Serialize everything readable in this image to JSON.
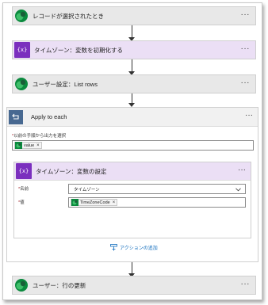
{
  "steps": {
    "trigger": {
      "title": "レコードが選択されたとき",
      "icon": "dataverse-icon"
    },
    "init_var": {
      "title": "タイムゾーン：変数を初期化する",
      "icon": "variable-icon"
    },
    "list_rows": {
      "title": "ユーザー設定：List rows",
      "icon": "dataverse-icon"
    },
    "update_row": {
      "title": "ユーザー：行の更新",
      "icon": "dataverse-icon"
    }
  },
  "apply_each": {
    "title": "Apply to each",
    "select_output_label": "以前の手順から出力を選択",
    "output_token": "value",
    "set_var": {
      "title": "タイムゾーン：変数の設定",
      "name_label": "名前",
      "name_value": "タイムゾーン",
      "value_label": "値",
      "value_token": "TimeZoneCode"
    },
    "add_action_label": "アクションの追加"
  },
  "more_glyph": "···",
  "required_mark": "*",
  "token_close": "×",
  "var_icon_text": "{x}",
  "colors": {
    "variable_purple": "#7b2fbe",
    "variable_header_bg": "#ebdff5",
    "loop_blue": "#486991",
    "link_blue": "#0f6cbd",
    "dataverse_green": "#0b8a3e"
  }
}
